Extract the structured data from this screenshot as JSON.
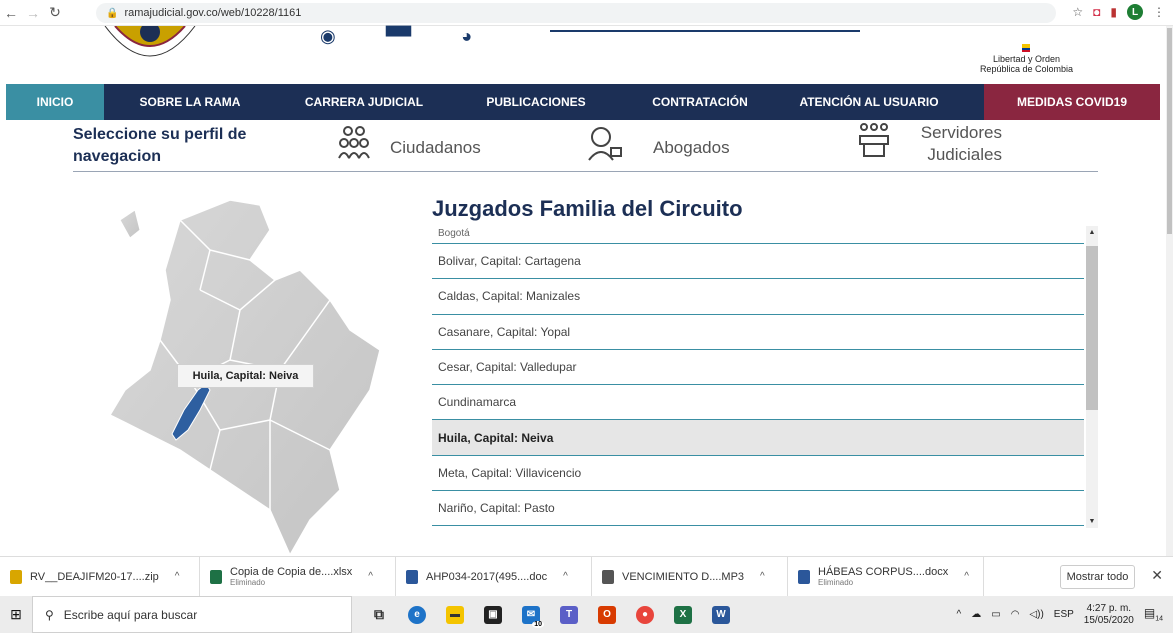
{
  "browser": {
    "url": "ramajudicial.gov.co/web/10228/1161",
    "avatar_letter": "L"
  },
  "header": {
    "right_logo_line1": "Libertad y Orden",
    "right_logo_line2": "República de Colombia"
  },
  "nav": {
    "items": [
      {
        "label": "INICIO"
      },
      {
        "label": "SOBRE LA RAMA"
      },
      {
        "label": "CARRERA JUDICIAL"
      },
      {
        "label": "PUBLICACIONES"
      },
      {
        "label": "CONTRATACIÓN"
      },
      {
        "label": "ATENCIÓN AL USUARIO"
      },
      {
        "label": "MEDIDAS COVID19"
      }
    ]
  },
  "profile": {
    "title": "Seleccione su perfil de navegacion",
    "options": [
      {
        "label": "Ciudadanos"
      },
      {
        "label": "Abogados"
      },
      {
        "label": "Servidores Judiciales"
      }
    ]
  },
  "map": {
    "tooltip": "Huila, Capital: Neiva",
    "highlight_color": "#2e5fa0"
  },
  "list": {
    "title": "Juzgados Familia del Circuito",
    "partial_item": "Bogotá",
    "items": [
      "Bolivar, Capital: Cartagena",
      "Caldas, Capital: Manizales",
      "Casanare, Capital: Yopal",
      "Cesar, Capital: Valledupar",
      "Cundinamarca",
      "Huila, Capital: Neiva",
      "Meta, Capital: Villavicencio",
      "Nariño, Capital: Pasto"
    ],
    "selected": "Huila, Capital: Neiva"
  },
  "downloads": {
    "items": [
      {
        "name": "RV__DEAJIFM20-17....zip",
        "sub": "",
        "color": "#d8a600"
      },
      {
        "name": "Copia de Copia de....xlsx",
        "sub": "Eliminado",
        "color": "#1e7145"
      },
      {
        "name": "AHP034-2017(495....doc",
        "sub": "",
        "color": "#2b579a"
      },
      {
        "name": "VENCIMIENTO D....MP3",
        "sub": "",
        "color": "#555555"
      },
      {
        "name": "HÁBEAS CORPUS....docx",
        "sub": "Eliminado",
        "color": "#2b579a"
      }
    ],
    "show_all": "Mostrar todo"
  },
  "taskbar": {
    "search_placeholder": "Escribe aquí para buscar",
    "lang": "ESP",
    "time": "4:27 p. m.",
    "date": "15/05/2020",
    "notification_count": "14",
    "mail_badge": "10"
  }
}
